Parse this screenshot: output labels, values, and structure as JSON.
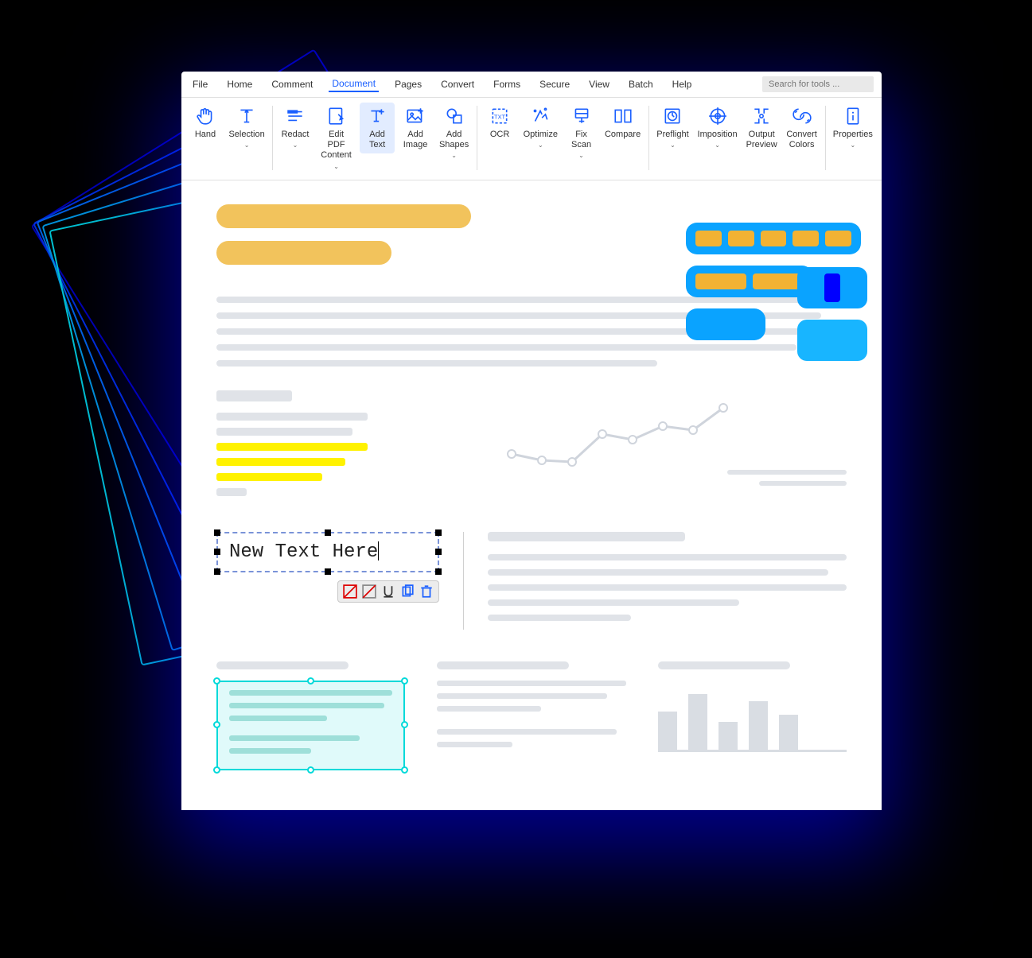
{
  "menu": {
    "items": [
      "File",
      "Home",
      "Comment",
      "Document",
      "Pages",
      "Convert",
      "Forms",
      "Secure",
      "View",
      "Batch",
      "Help"
    ],
    "active_index": 3,
    "search_placeholder": "Search for tools ..."
  },
  "ribbon": {
    "buttons": [
      {
        "id": "hand",
        "label": "Hand",
        "chev": false
      },
      {
        "id": "selection",
        "label": "Selection",
        "chev": true
      },
      {
        "id": "redact",
        "label": "Redact",
        "chev": true,
        "div_before": true
      },
      {
        "id": "edit-pdf-content",
        "label": "Edit PDF\nContent",
        "chev": true
      },
      {
        "id": "add-text",
        "label": "Add\nText",
        "chev": false,
        "active": true
      },
      {
        "id": "add-image",
        "label": "Add\nImage",
        "chev": false
      },
      {
        "id": "add-shapes",
        "label": "Add\nShapes",
        "chev": true
      },
      {
        "id": "ocr",
        "label": "OCR",
        "chev": false,
        "div_before": true
      },
      {
        "id": "optimize",
        "label": "Optimize",
        "chev": true
      },
      {
        "id": "fix-scan",
        "label": "Fix\nScan",
        "chev": true
      },
      {
        "id": "compare",
        "label": "Compare",
        "chev": false
      },
      {
        "id": "preflight",
        "label": "Preflight",
        "chev": true,
        "div_before": true
      },
      {
        "id": "imposition",
        "label": "Imposition",
        "chev": true
      },
      {
        "id": "output-preview",
        "label": "Output\nPreview",
        "chev": false
      },
      {
        "id": "convert-colors",
        "label": "Convert\nColors",
        "chev": false
      },
      {
        "id": "properties",
        "label": "Properties",
        "chev": true,
        "div_before": true
      }
    ]
  },
  "document": {
    "text_edit_value": "New Text Here"
  },
  "chart_data": {
    "type": "line",
    "x": [
      0,
      1,
      2,
      3,
      4,
      5,
      6,
      7
    ],
    "values": [
      40,
      32,
      30,
      55,
      48,
      62,
      58,
      78
    ],
    "ylim": [
      0,
      100
    ]
  }
}
